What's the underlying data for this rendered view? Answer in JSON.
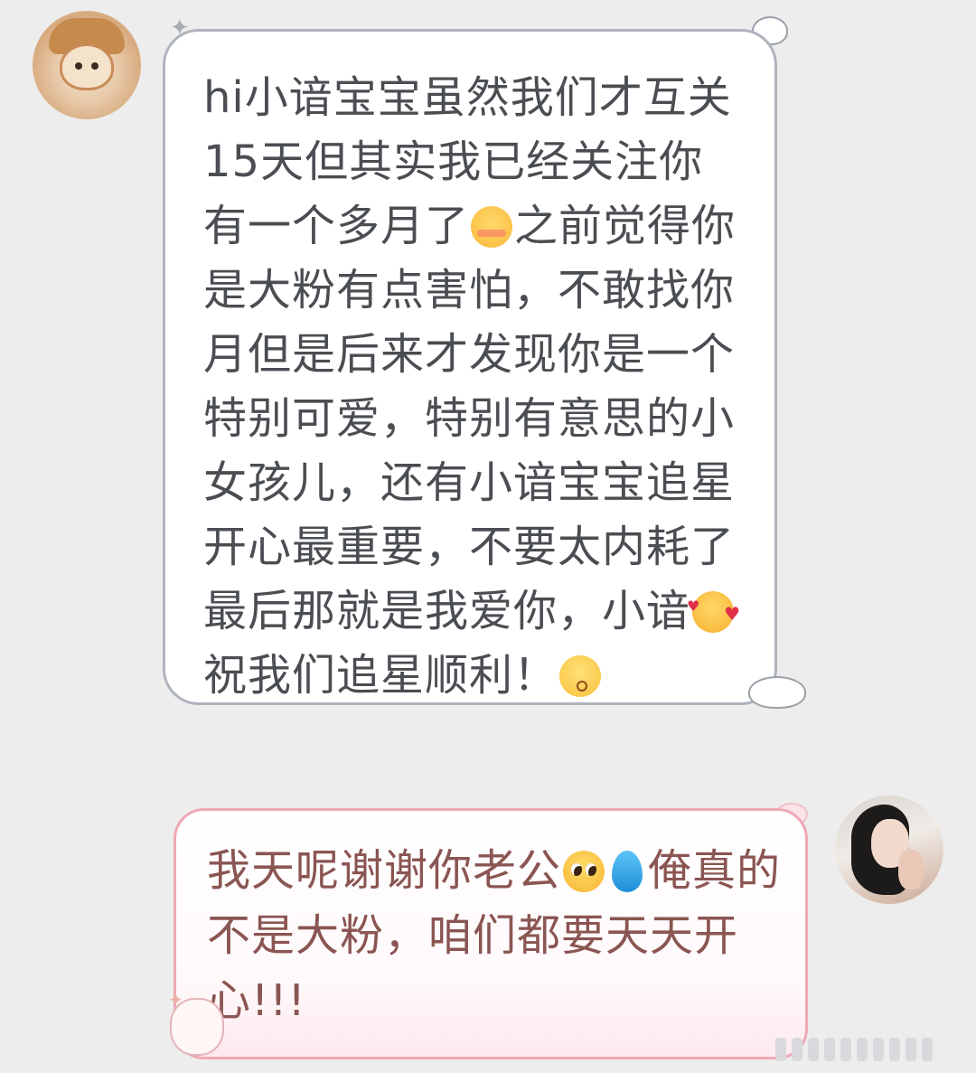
{
  "messages": [
    {
      "side": "left",
      "segments": [
        {
          "type": "text",
          "value": "hi小谙宝宝虽然我们才互关15天但其实我已经关注你有一个多月了"
        },
        {
          "type": "emoji",
          "name": "blushing-face-emoji"
        },
        {
          "type": "text",
          "value": "之前觉得你是大粉有点害怕，不敢找你月但是后来才发现你是一个特别可爱，特别有意思的小女孩儿，还有小谙宝宝追星开心最重要，不要太内耗了最后那就是我爱你，小谙"
        },
        {
          "type": "emoji",
          "name": "smiling-face-with-hearts-emoji"
        },
        {
          "type": "text",
          "value": "祝我们追星顺利！"
        },
        {
          "type": "emoji",
          "name": "kissing-face-emoji"
        }
      ]
    },
    {
      "side": "right",
      "segments": [
        {
          "type": "text",
          "value": "我天呢谢谢你老公"
        },
        {
          "type": "emoji",
          "name": "pleading-face-emoji"
        },
        {
          "type": "emoji",
          "name": "droplet-emoji"
        },
        {
          "type": "text",
          "value": "俺真的不是大粉，咱们都要天天开心!!!"
        }
      ]
    }
  ],
  "icons": {
    "left_avatar": "avatar-plush-bear-icon",
    "right_avatar": "avatar-user-photo-icon"
  },
  "colors": {
    "background": "#ededed",
    "left_bubble_border": "#aeb3bc",
    "right_bubble_border": "#f0a8b6",
    "left_text": "#4a4d52",
    "right_text": "#8a5552"
  }
}
